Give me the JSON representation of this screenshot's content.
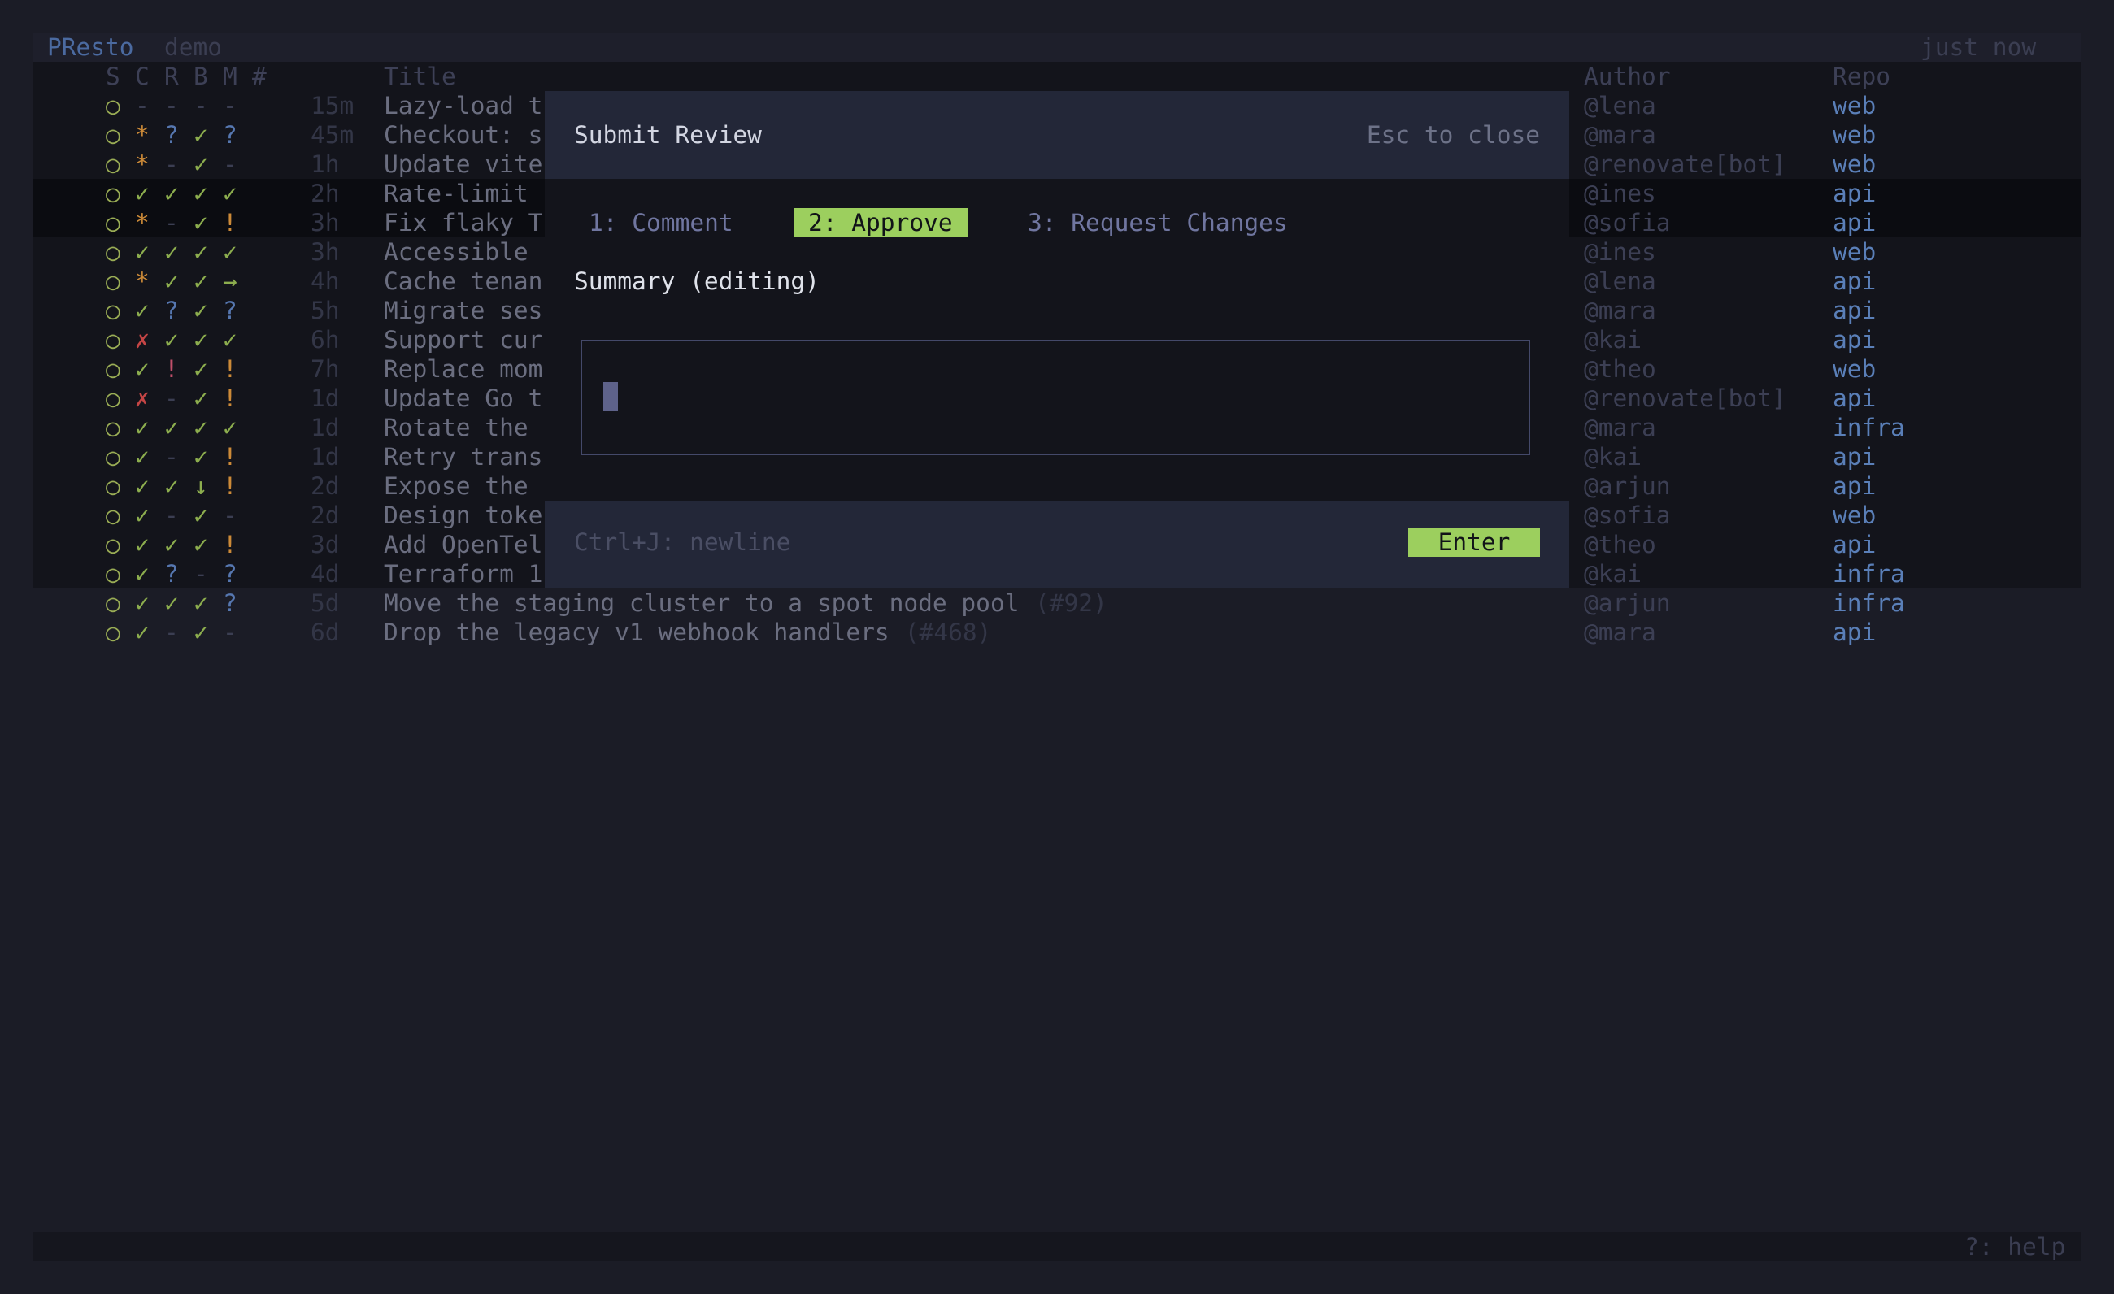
{
  "app": {
    "name": "PResto",
    "mode": "demo",
    "updated": "just now"
  },
  "columns": {
    "s": "S",
    "c": "C",
    "r": "R",
    "b": "B",
    "m": "M",
    "num": "#",
    "title": "Title",
    "author": "Author",
    "repo": "Repo"
  },
  "rows": [
    {
      "s": "○",
      "c": "-",
      "r": "-",
      "b": "-",
      "m": "-",
      "age": "15m",
      "title": "Lazy-load t",
      "pr": "",
      "author": "@lena",
      "repo": "web"
    },
    {
      "s": "○",
      "c": "*",
      "r": "?",
      "b": "✓",
      "m": "?",
      "age": "45m",
      "title": "Checkout: s",
      "pr": "",
      "author": "@mara",
      "repo": "web"
    },
    {
      "s": "○",
      "c": "*",
      "r": "-",
      "b": "✓",
      "m": "-",
      "age": "1h",
      "title": "Update vite",
      "pr": "",
      "author": "@renovate[bot]",
      "repo": "web"
    },
    {
      "s": "○",
      "c": "✓",
      "r": "✓",
      "b": "✓",
      "m": "✓",
      "age": "2h",
      "title": "Rate-limit",
      "pr": "",
      "author": "@ines",
      "repo": "api"
    },
    {
      "s": "○",
      "c": "*",
      "r": "-",
      "b": "✓",
      "m": "!",
      "age": "3h",
      "title": "Fix flaky T",
      "pr": "",
      "author": "@sofia",
      "repo": "api"
    },
    {
      "s": "○",
      "c": "✓",
      "r": "✓",
      "b": "✓",
      "m": "✓",
      "age": "3h",
      "title": "Accessible",
      "pr": "",
      "author": "@ines",
      "repo": "web"
    },
    {
      "s": "○",
      "c": "*",
      "r": "✓",
      "b": "✓",
      "m": "→",
      "age": "4h",
      "title": "Cache tenan",
      "pr": "",
      "author": "@lena",
      "repo": "api"
    },
    {
      "s": "○",
      "c": "✓",
      "r": "?",
      "b": "✓",
      "m": "?",
      "age": "5h",
      "title": "Migrate ses",
      "pr": "",
      "author": "@mara",
      "repo": "api"
    },
    {
      "s": "○",
      "c": "✗",
      "r": "✓",
      "b": "✓",
      "m": "✓",
      "age": "6h",
      "title": "Support cur",
      "pr": "",
      "author": "@kai",
      "repo": "api"
    },
    {
      "s": "○",
      "c": "✓",
      "r": "!",
      "b": "✓",
      "m": "!",
      "age": "7h",
      "title": "Replace mom",
      "pr": "",
      "author": "@theo",
      "repo": "web"
    },
    {
      "s": "○",
      "c": "✗",
      "r": "-",
      "b": "✓",
      "m": "!",
      "age": "1d",
      "title": "Update Go t",
      "pr": "",
      "author": "@renovate[bot]",
      "repo": "api"
    },
    {
      "s": "○",
      "c": "✓",
      "r": "✓",
      "b": "✓",
      "m": "✓",
      "age": "1d",
      "title": "Rotate the",
      "pr": "",
      "author": "@mara",
      "repo": "infra"
    },
    {
      "s": "○",
      "c": "✓",
      "r": "-",
      "b": "✓",
      "m": "!",
      "age": "1d",
      "title": "Retry trans",
      "pr": "",
      "author": "@kai",
      "repo": "api"
    },
    {
      "s": "○",
      "c": "✓",
      "r": "✓",
      "b": "↓",
      "m": "!",
      "age": "2d",
      "title": "Expose the",
      "pr": "",
      "author": "@arjun",
      "repo": "api"
    },
    {
      "s": "○",
      "c": "✓",
      "r": "-",
      "b": "✓",
      "m": "-",
      "age": "2d",
      "title": "Design toke",
      "pr": "",
      "author": "@sofia",
      "repo": "web"
    },
    {
      "s": "○",
      "c": "✓",
      "r": "✓",
      "b": "✓",
      "m": "!",
      "age": "3d",
      "title": "Add OpenTel",
      "pr": "",
      "author": "@theo",
      "repo": "api"
    },
    {
      "s": "○",
      "c": "✓",
      "r": "?",
      "b": "-",
      "m": "?",
      "age": "4d",
      "title": "Terraform 1",
      "pr": "",
      "author": "@kai",
      "repo": "infra"
    },
    {
      "s": "○",
      "c": "✓",
      "r": "✓",
      "b": "✓",
      "m": "?",
      "age": "5d",
      "title": "Move the staging cluster to a spot node pool",
      "pr": "(#92)",
      "author": "@arjun",
      "repo": "infra"
    },
    {
      "s": "○",
      "c": "✓",
      "r": "-",
      "b": "✓",
      "m": "-",
      "age": "6d",
      "title": "Drop the legacy v1 webhook handlers",
      "pr": "(#468)",
      "author": "@mara",
      "repo": "api"
    }
  ],
  "modal": {
    "title": "Submit Review",
    "close_hint": "Esc to close",
    "tabs": [
      {
        "label": "1: Comment",
        "active": false
      },
      {
        "label": "2: Approve",
        "active": true
      },
      {
        "label": "3: Request Changes",
        "active": false
      }
    ],
    "summary_label": "Summary (editing)",
    "summary_value": "",
    "newline_hint": "Ctrl+J: newline",
    "submit_label": "Enter"
  },
  "status": {
    "help": "?: help"
  },
  "colors": {
    "accent": "#9ccf5e",
    "background": "#1b1c26",
    "repo": "#5a7fb8"
  }
}
